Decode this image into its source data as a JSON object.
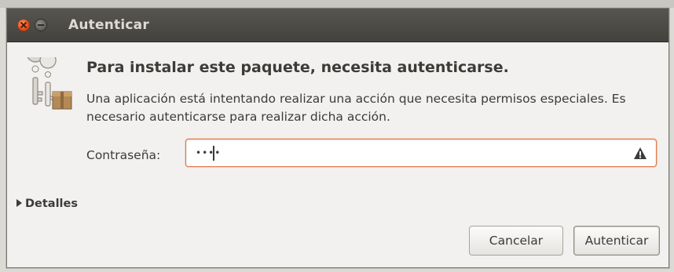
{
  "window": {
    "title": "Autenticar"
  },
  "dialog": {
    "heading": "Para instalar este paquete, necesita autenticarse.",
    "message": "Una aplicación está intentando realizar una acción que necesita permisos especiales. Es necesario autenticarse para realizar dicha acción.",
    "icon": "keys-authentication-icon"
  },
  "password": {
    "label": "Contraseña:",
    "masked_value": "••••",
    "warning_icon": "warning-icon"
  },
  "details": {
    "label": "Detalles",
    "expanded": false
  },
  "buttons": {
    "cancel_label": "Cancelar",
    "authenticate_label": "Autenticar"
  },
  "colors": {
    "titlebar": "#4a4945",
    "window_bg": "#f2f1f0",
    "close_button": "#df4a16",
    "field_focus_border": "#e07a4c",
    "text": "#3c3b37"
  }
}
